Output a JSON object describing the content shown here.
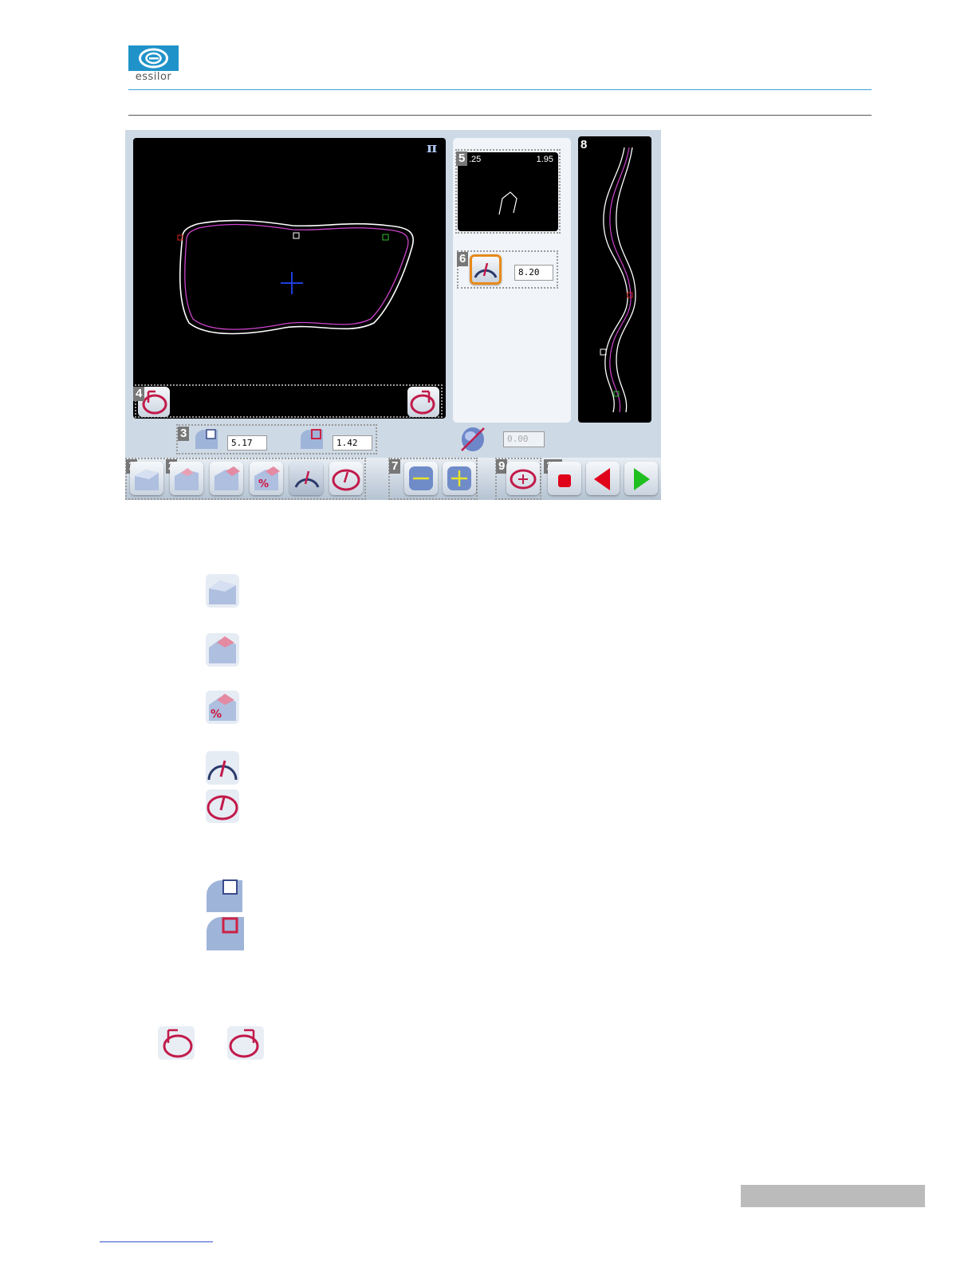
{
  "brand": {
    "logo_text": "essilor",
    "logo_color": "#1f93c9"
  },
  "screen": {
    "labels": {
      "l1": "1",
      "l2": "2",
      "l3": "3",
      "l4": "4",
      "l5": "5",
      "l6": "6",
      "l7": "7",
      "l8": "8",
      "l9": "9",
      "l10": "10"
    },
    "bevel_preview": {
      "left_value": ".25",
      "right_value": "1.95"
    },
    "curve_field": {
      "value": "8.20"
    },
    "bevel_position_fields": {
      "front": "5.17",
      "rear": "1.42"
    },
    "tilt_field": {
      "value": "0.00"
    }
  },
  "icons": {
    "main_view": "lens-shape-with-bevel-trace",
    "toolbar": [
      "bevel-auto-icon",
      "bevel-front-icon",
      "bevel-back-icon",
      "bevel-percent-icon",
      "curve-arc-icon",
      "curve-oval-icon",
      "minus-icon",
      "plus-icon",
      "recenter-icon",
      "stop-icon",
      "back-arrow-icon",
      "forward-arrow-icon"
    ]
  },
  "colors": {
    "accent_blue": "#3ba3d6",
    "bevel_trace": "#cc44cc",
    "stop_red": "#e0001a",
    "go_green": "#1fbf1f"
  }
}
